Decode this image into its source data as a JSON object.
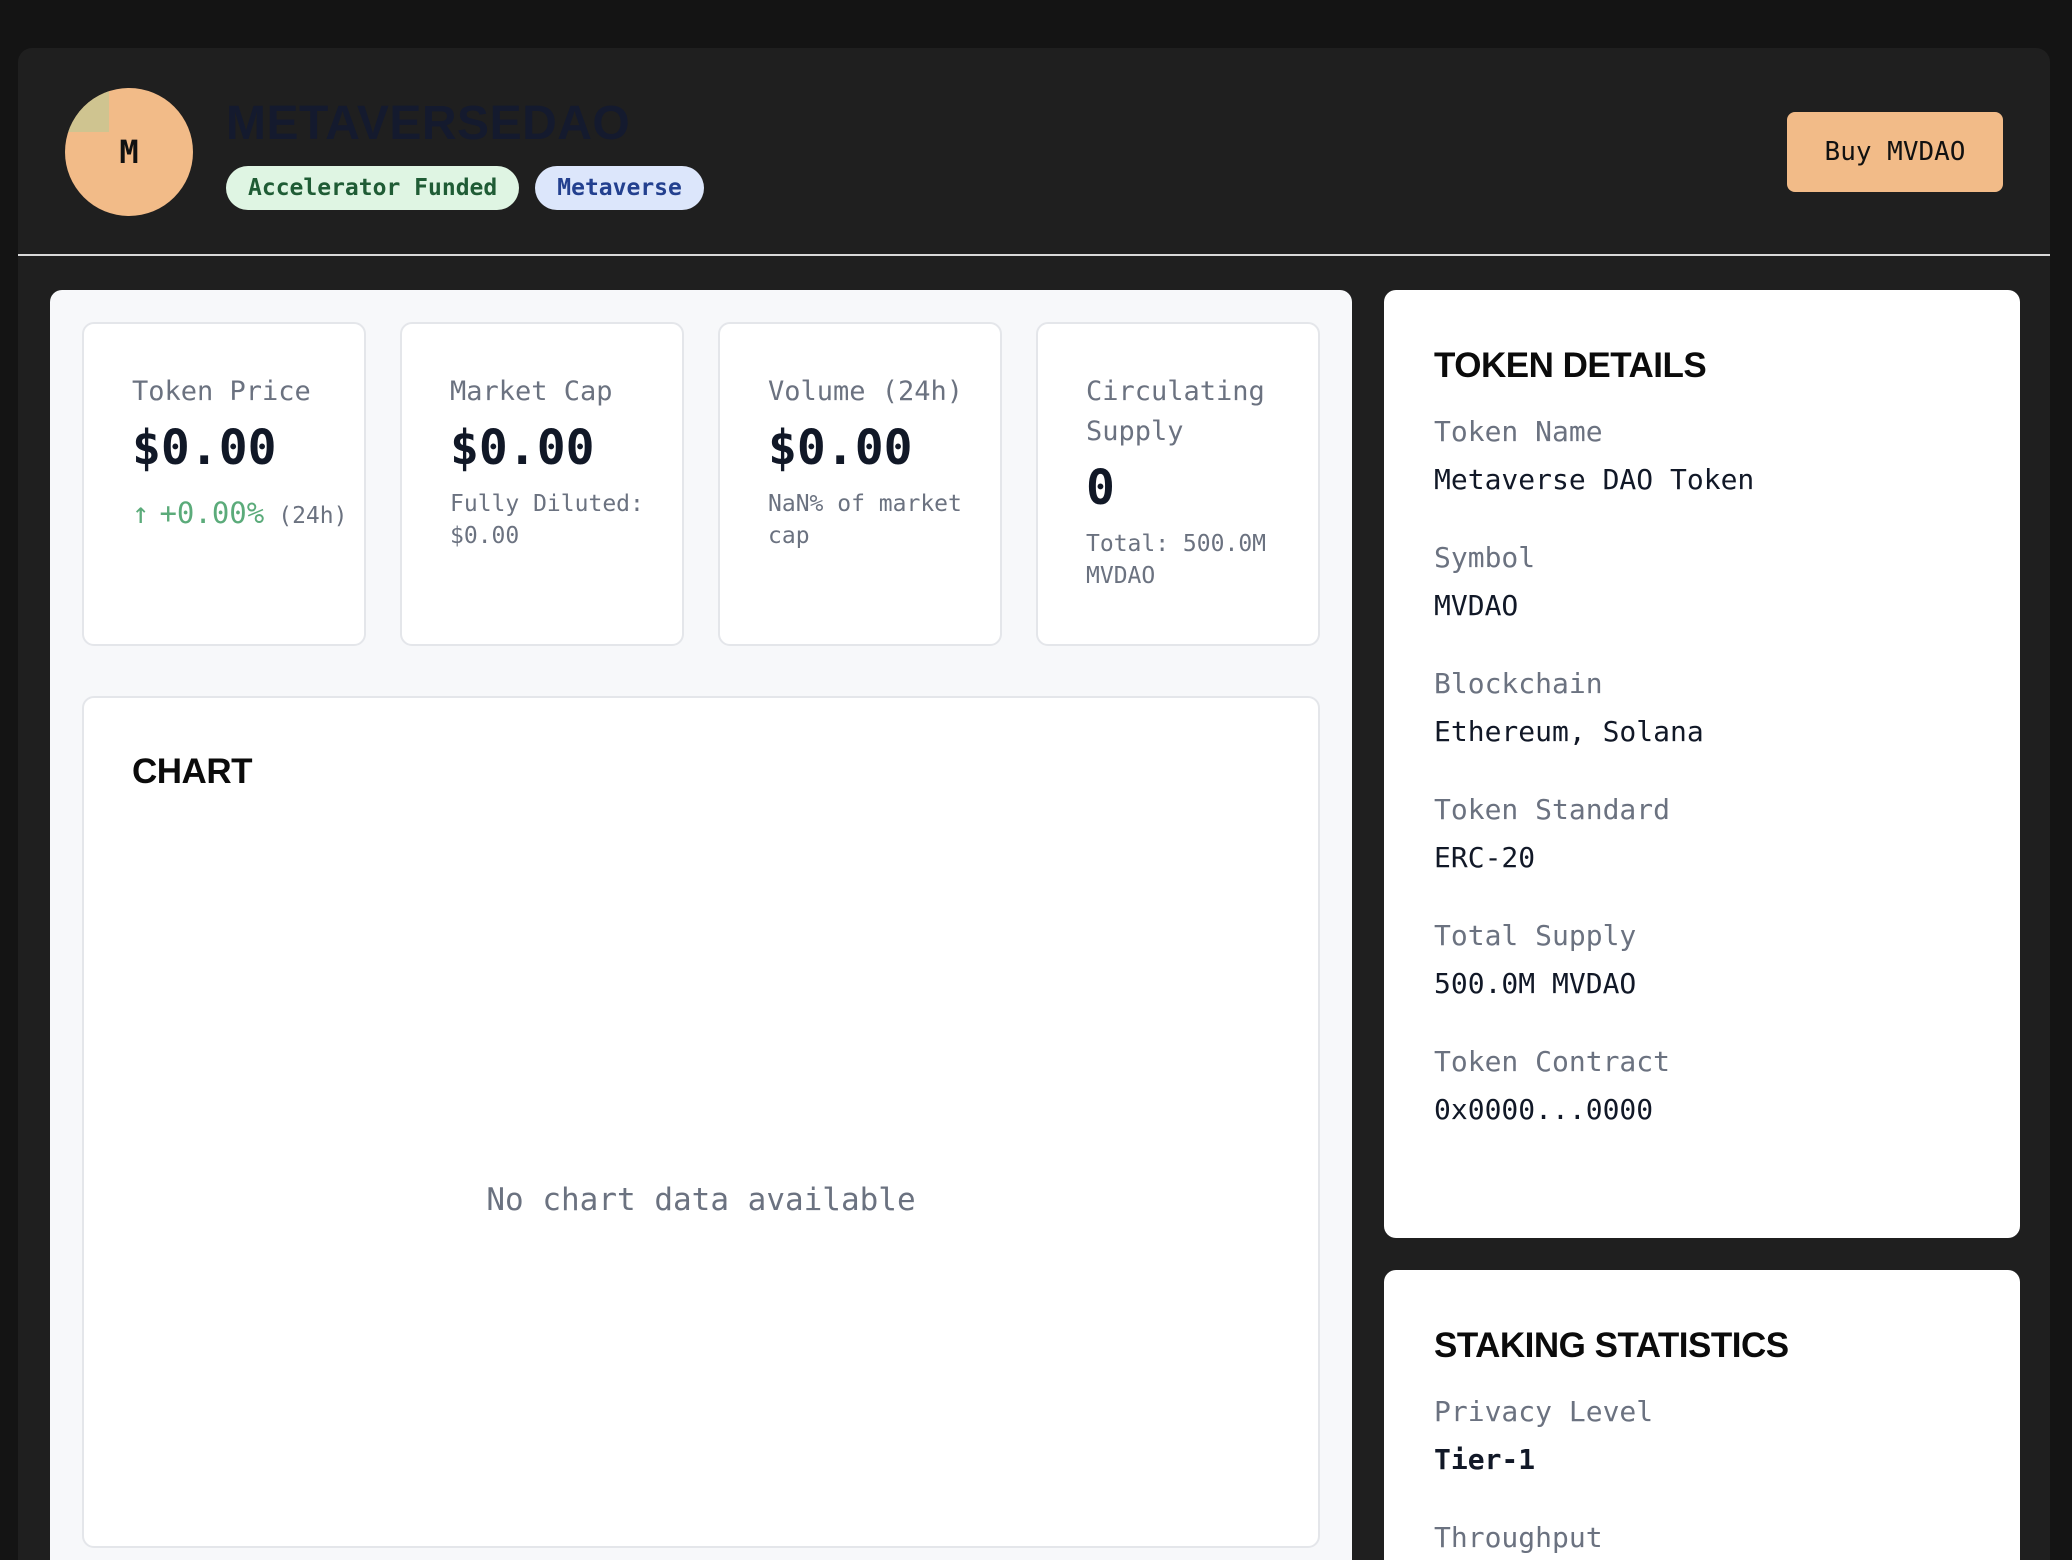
{
  "header": {
    "logo_letter": "M",
    "title": "METAVERSEDAO",
    "tags": [
      "Accelerator Funded",
      "Metaverse"
    ],
    "buy_label": "Buy MVDAO"
  },
  "stats": {
    "price": {
      "label": "Token Price",
      "value": "$0.00",
      "change_arrow": "↑",
      "change": "+0.00%",
      "change_period": "(24h)"
    },
    "market_cap": {
      "label": "Market Cap",
      "value": "$0.00",
      "sub": "Fully Diluted: $0.00"
    },
    "volume": {
      "label": "Volume (24h)",
      "value": "$0.00",
      "sub": "NaN% of market cap"
    },
    "circulating": {
      "label": "Circulating Supply",
      "value": "0",
      "sub": "Total: 500.0M MVDAO"
    }
  },
  "chart": {
    "heading": "CHART",
    "empty_message": "No chart data available"
  },
  "details": {
    "heading": "TOKEN DETAILS",
    "fields": [
      {
        "label": "Token Name",
        "value": "Metaverse DAO Token"
      },
      {
        "label": "Symbol",
        "value": "MVDAO"
      },
      {
        "label": "Blockchain",
        "value": "Ethereum, Solana"
      },
      {
        "label": "Token Standard",
        "value": "ERC-20"
      },
      {
        "label": "Total Supply",
        "value": "500.0M MVDAO"
      },
      {
        "label": "Token Contract",
        "value": "0x0000...0000"
      }
    ]
  },
  "staking": {
    "heading": "STAKING STATISTICS",
    "fields": [
      {
        "label": "Privacy Level",
        "value": "Tier-1"
      },
      {
        "label": "Throughput",
        "value": ""
      }
    ]
  },
  "colors": {
    "accent": "#f2bb88",
    "positive": "#5bab7a",
    "tag_green_bg": "#dff5e3",
    "tag_blue_bg": "#dce6fb"
  }
}
